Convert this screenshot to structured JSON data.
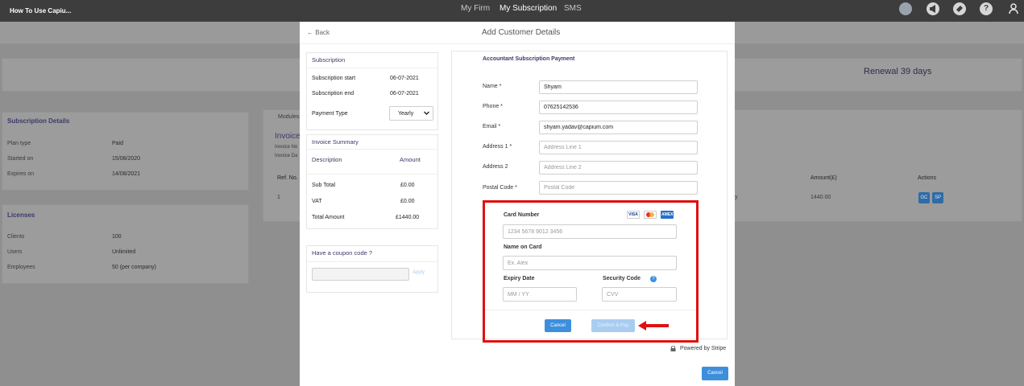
{
  "topnav": {
    "brand": "How To Use Capiu...",
    "links": [
      "My Firm",
      "My Subscription",
      "SMS"
    ],
    "icons": [
      "user-circle-icon",
      "megaphone-icon",
      "ticket-icon",
      "help-icon",
      "profile-icon"
    ],
    "help_glyph": "?"
  },
  "background": {
    "renewal": "Renewal 39 days",
    "subscription_details": {
      "title": "Subscription Details",
      "rows": [
        {
          "label": "Plan type",
          "value": "Paid"
        },
        {
          "label": "Started on",
          "value": "15/08/2020"
        },
        {
          "label": "Expires on",
          "value": "14/08/2021"
        }
      ]
    },
    "licenses": {
      "title": "Licenses",
      "rows": [
        {
          "label": "Clients",
          "value": "100"
        },
        {
          "label": "Users",
          "value": "Unlimited"
        },
        {
          "label": "Employees",
          "value": "50 (per company)"
        }
      ]
    },
    "invoices": {
      "tab": "Modules",
      "title": "Invoice",
      "sub1": "Invoice No",
      "sub2": "Invoice Da",
      "col_ref": "Ref. No.",
      "col_amount": "Amount(£)",
      "col_actions": "Actions",
      "row_ref": "1",
      "row_amount": "1440.00",
      "row_y": "y",
      "btn_gc": "GC",
      "btn_sp": "SP"
    }
  },
  "modal": {
    "back": "Back",
    "back_arrow": "←",
    "title": "Add Customer Details",
    "subscription": {
      "title": "Subscription",
      "start_label": "Subscription start",
      "start_value": "06-07-2021",
      "end_label": "Subscription end",
      "end_value": "06-07-2021",
      "payment_type_label": "Payment Type",
      "payment_type_value": "Yearly"
    },
    "invoice_summary": {
      "title": "Invoice Summary",
      "col_description": "Description",
      "col_amount": "Amount",
      "rows": [
        {
          "label": "Sub Total",
          "value": "£0.00"
        },
        {
          "label": "VAT",
          "value": "£0.00"
        },
        {
          "label": "Total Amount",
          "value": "£1440.00"
        }
      ]
    },
    "coupon": {
      "title": "Have a coupon code ?",
      "apply": "Apply"
    },
    "payment": {
      "title": "Accountant Subscription Payment",
      "name_label": "Name *",
      "name_value": "Shyam",
      "phone_label": "Phone *",
      "phone_value": "07625142536",
      "email_label": "Email *",
      "email_value": "shyam.yadav@capium.com",
      "address1_label": "Address 1 *",
      "address1_placeholder": "Address Line 1",
      "address2_label": "Address 2",
      "address2_placeholder": "Address Line 2",
      "postal_label": "Postal Code *",
      "postal_placeholder": "Postal Code"
    },
    "card": {
      "number_label": "Card Number",
      "number_placeholder": "1234 5678 9012 3456",
      "name_label": "Name on Card",
      "name_placeholder": "Ex. Alex",
      "expiry_label": "Expiry Date",
      "expiry_placeholder": "MM / YY",
      "security_label": "Security Code",
      "security_placeholder": "CVV",
      "logos": [
        "VISA",
        "MC",
        "AMEX"
      ],
      "cancel": "Cancel",
      "confirm": "Confirm & Pay",
      "powered": "Powered by Stripe"
    },
    "footer_cancel": "Cancel"
  },
  "colors": {
    "accent_button": "#3d8fdc",
    "annotation_red": "#e01010",
    "nav_bg": "#3d3d3d"
  }
}
